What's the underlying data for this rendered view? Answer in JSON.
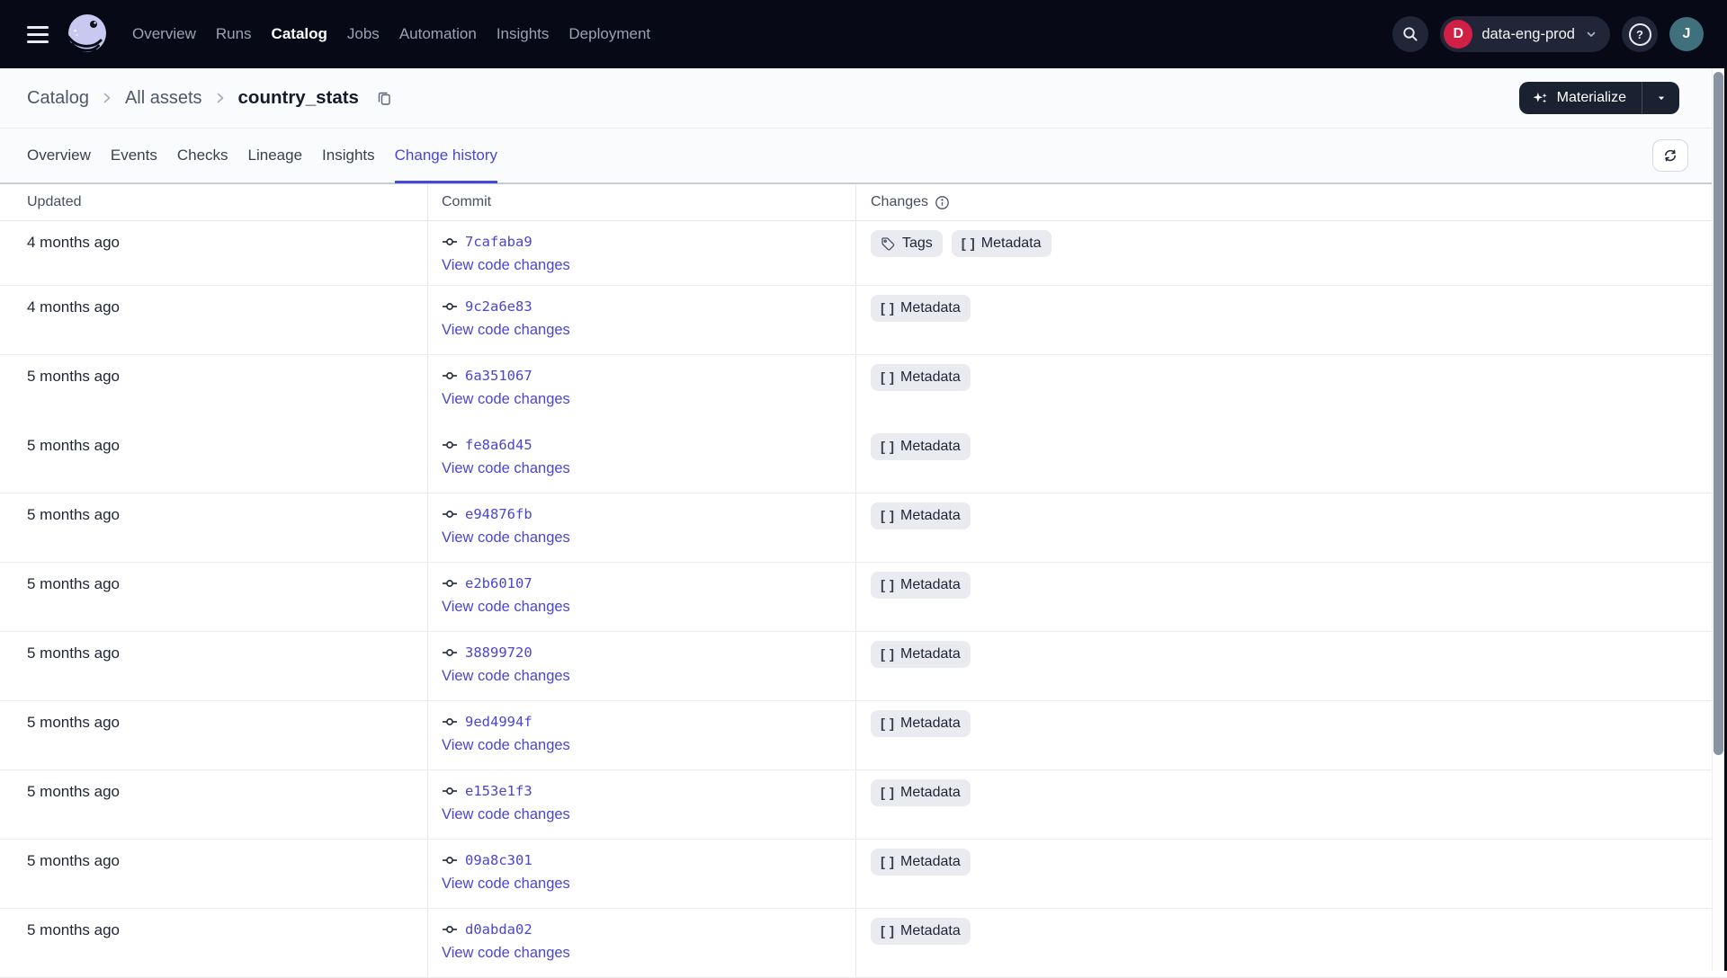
{
  "topnav": {
    "menu_items": [
      {
        "label": "Overview",
        "active": false
      },
      {
        "label": "Runs",
        "active": false
      },
      {
        "label": "Catalog",
        "active": true
      },
      {
        "label": "Jobs",
        "active": false
      },
      {
        "label": "Automation",
        "active": false
      },
      {
        "label": "Insights",
        "active": false
      },
      {
        "label": "Deployment",
        "active": false
      }
    ],
    "workspace": {
      "initial": "D",
      "name": "data-eng-prod"
    },
    "user_initial": "J"
  },
  "header": {
    "breadcrumb": {
      "links": [
        "Catalog",
        "All assets"
      ],
      "current": "country_stats"
    },
    "materialize_label": "Materialize"
  },
  "tabs": [
    {
      "label": "Overview",
      "active": false
    },
    {
      "label": "Events",
      "active": false
    },
    {
      "label": "Checks",
      "active": false
    },
    {
      "label": "Lineage",
      "active": false
    },
    {
      "label": "Insights",
      "active": false
    },
    {
      "label": "Change history",
      "active": true
    }
  ],
  "table": {
    "columns": [
      "Updated",
      "Commit",
      "Changes"
    ],
    "view_link_label": "View code changes",
    "rows": [
      {
        "updated": "4 months ago",
        "commit": "7cafaba9",
        "changes": [
          {
            "label": "Tags",
            "icon": "tag"
          },
          {
            "label": "Metadata",
            "icon": "brackets"
          }
        ],
        "divider_below": true
      },
      {
        "updated": "4 months ago",
        "commit": "9c2a6e83",
        "changes": [
          {
            "label": "Metadata",
            "icon": "brackets"
          }
        ],
        "divider_below": true
      },
      {
        "updated": "5 months ago",
        "commit": "6a351067",
        "changes": [
          {
            "label": "Metadata",
            "icon": "brackets"
          }
        ],
        "divider_below": false
      },
      {
        "updated": "5 months ago",
        "commit": "fe8a6d45",
        "changes": [
          {
            "label": "Metadata",
            "icon": "brackets"
          }
        ],
        "divider_below": true
      },
      {
        "updated": "5 months ago",
        "commit": "e94876fb",
        "changes": [
          {
            "label": "Metadata",
            "icon": "brackets"
          }
        ],
        "divider_below": true
      },
      {
        "updated": "5 months ago",
        "commit": "e2b60107",
        "changes": [
          {
            "label": "Metadata",
            "icon": "brackets"
          }
        ],
        "divider_below": true
      },
      {
        "updated": "5 months ago",
        "commit": "38899720",
        "changes": [
          {
            "label": "Metadata",
            "icon": "brackets"
          }
        ],
        "divider_below": true
      },
      {
        "updated": "5 months ago",
        "commit": "9ed4994f",
        "changes": [
          {
            "label": "Metadata",
            "icon": "brackets"
          }
        ],
        "divider_below": true
      },
      {
        "updated": "5 months ago",
        "commit": "e153e1f3",
        "changes": [
          {
            "label": "Metadata",
            "icon": "brackets"
          }
        ],
        "divider_below": true
      },
      {
        "updated": "5 months ago",
        "commit": "09a8c301",
        "changes": [
          {
            "label": "Metadata",
            "icon": "brackets"
          }
        ],
        "divider_below": true
      },
      {
        "updated": "5 months ago",
        "commit": "d0abda02",
        "changes": [
          {
            "label": "Metadata",
            "icon": "brackets"
          }
        ],
        "divider_below": true
      }
    ]
  },
  "colors": {
    "accent": "#4A46D6",
    "link": "#4A45D2",
    "topnav_bg": "#070A16",
    "workspace_badge": "#D11F46",
    "avatar": "#40707C",
    "badge_bg": "#E9EBF0"
  }
}
